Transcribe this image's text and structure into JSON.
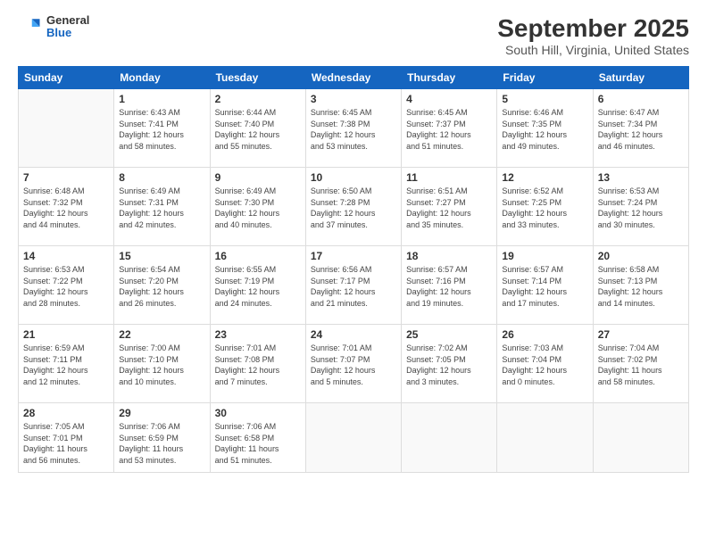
{
  "header": {
    "logo_general": "General",
    "logo_blue": "Blue",
    "main_title": "September 2025",
    "sub_title": "South Hill, Virginia, United States"
  },
  "calendar": {
    "days_of_week": [
      "Sunday",
      "Monday",
      "Tuesday",
      "Wednesday",
      "Thursday",
      "Friday",
      "Saturday"
    ],
    "weeks": [
      [
        {
          "day": "",
          "sunrise": "",
          "sunset": "",
          "daylight": ""
        },
        {
          "day": "1",
          "sunrise": "Sunrise: 6:43 AM",
          "sunset": "Sunset: 7:41 PM",
          "daylight": "Daylight: 12 hours and 58 minutes."
        },
        {
          "day": "2",
          "sunrise": "Sunrise: 6:44 AM",
          "sunset": "Sunset: 7:40 PM",
          "daylight": "Daylight: 12 hours and 55 minutes."
        },
        {
          "day": "3",
          "sunrise": "Sunrise: 6:45 AM",
          "sunset": "Sunset: 7:38 PM",
          "daylight": "Daylight: 12 hours and 53 minutes."
        },
        {
          "day": "4",
          "sunrise": "Sunrise: 6:45 AM",
          "sunset": "Sunset: 7:37 PM",
          "daylight": "Daylight: 12 hours and 51 minutes."
        },
        {
          "day": "5",
          "sunrise": "Sunrise: 6:46 AM",
          "sunset": "Sunset: 7:35 PM",
          "daylight": "Daylight: 12 hours and 49 minutes."
        },
        {
          "day": "6",
          "sunrise": "Sunrise: 6:47 AM",
          "sunset": "Sunset: 7:34 PM",
          "daylight": "Daylight: 12 hours and 46 minutes."
        }
      ],
      [
        {
          "day": "7",
          "sunrise": "Sunrise: 6:48 AM",
          "sunset": "Sunset: 7:32 PM",
          "daylight": "Daylight: 12 hours and 44 minutes."
        },
        {
          "day": "8",
          "sunrise": "Sunrise: 6:49 AM",
          "sunset": "Sunset: 7:31 PM",
          "daylight": "Daylight: 12 hours and 42 minutes."
        },
        {
          "day": "9",
          "sunrise": "Sunrise: 6:49 AM",
          "sunset": "Sunset: 7:30 PM",
          "daylight": "Daylight: 12 hours and 40 minutes."
        },
        {
          "day": "10",
          "sunrise": "Sunrise: 6:50 AM",
          "sunset": "Sunset: 7:28 PM",
          "daylight": "Daylight: 12 hours and 37 minutes."
        },
        {
          "day": "11",
          "sunrise": "Sunrise: 6:51 AM",
          "sunset": "Sunset: 7:27 PM",
          "daylight": "Daylight: 12 hours and 35 minutes."
        },
        {
          "day": "12",
          "sunrise": "Sunrise: 6:52 AM",
          "sunset": "Sunset: 7:25 PM",
          "daylight": "Daylight: 12 hours and 33 minutes."
        },
        {
          "day": "13",
          "sunrise": "Sunrise: 6:53 AM",
          "sunset": "Sunset: 7:24 PM",
          "daylight": "Daylight: 12 hours and 30 minutes."
        }
      ],
      [
        {
          "day": "14",
          "sunrise": "Sunrise: 6:53 AM",
          "sunset": "Sunset: 7:22 PM",
          "daylight": "Daylight: 12 hours and 28 minutes."
        },
        {
          "day": "15",
          "sunrise": "Sunrise: 6:54 AM",
          "sunset": "Sunset: 7:20 PM",
          "daylight": "Daylight: 12 hours and 26 minutes."
        },
        {
          "day": "16",
          "sunrise": "Sunrise: 6:55 AM",
          "sunset": "Sunset: 7:19 PM",
          "daylight": "Daylight: 12 hours and 24 minutes."
        },
        {
          "day": "17",
          "sunrise": "Sunrise: 6:56 AM",
          "sunset": "Sunset: 7:17 PM",
          "daylight": "Daylight: 12 hours and 21 minutes."
        },
        {
          "day": "18",
          "sunrise": "Sunrise: 6:57 AM",
          "sunset": "Sunset: 7:16 PM",
          "daylight": "Daylight: 12 hours and 19 minutes."
        },
        {
          "day": "19",
          "sunrise": "Sunrise: 6:57 AM",
          "sunset": "Sunset: 7:14 PM",
          "daylight": "Daylight: 12 hours and 17 minutes."
        },
        {
          "day": "20",
          "sunrise": "Sunrise: 6:58 AM",
          "sunset": "Sunset: 7:13 PM",
          "daylight": "Daylight: 12 hours and 14 minutes."
        }
      ],
      [
        {
          "day": "21",
          "sunrise": "Sunrise: 6:59 AM",
          "sunset": "Sunset: 7:11 PM",
          "daylight": "Daylight: 12 hours and 12 minutes."
        },
        {
          "day": "22",
          "sunrise": "Sunrise: 7:00 AM",
          "sunset": "Sunset: 7:10 PM",
          "daylight": "Daylight: 12 hours and 10 minutes."
        },
        {
          "day": "23",
          "sunrise": "Sunrise: 7:01 AM",
          "sunset": "Sunset: 7:08 PM",
          "daylight": "Daylight: 12 hours and 7 minutes."
        },
        {
          "day": "24",
          "sunrise": "Sunrise: 7:01 AM",
          "sunset": "Sunset: 7:07 PM",
          "daylight": "Daylight: 12 hours and 5 minutes."
        },
        {
          "day": "25",
          "sunrise": "Sunrise: 7:02 AM",
          "sunset": "Sunset: 7:05 PM",
          "daylight": "Daylight: 12 hours and 3 minutes."
        },
        {
          "day": "26",
          "sunrise": "Sunrise: 7:03 AM",
          "sunset": "Sunset: 7:04 PM",
          "daylight": "Daylight: 12 hours and 0 minutes."
        },
        {
          "day": "27",
          "sunrise": "Sunrise: 7:04 AM",
          "sunset": "Sunset: 7:02 PM",
          "daylight": "Daylight: 11 hours and 58 minutes."
        }
      ],
      [
        {
          "day": "28",
          "sunrise": "Sunrise: 7:05 AM",
          "sunset": "Sunset: 7:01 PM",
          "daylight": "Daylight: 11 hours and 56 minutes."
        },
        {
          "day": "29",
          "sunrise": "Sunrise: 7:06 AM",
          "sunset": "Sunset: 6:59 PM",
          "daylight": "Daylight: 11 hours and 53 minutes."
        },
        {
          "day": "30",
          "sunrise": "Sunrise: 7:06 AM",
          "sunset": "Sunset: 6:58 PM",
          "daylight": "Daylight: 11 hours and 51 minutes."
        },
        {
          "day": "",
          "sunrise": "",
          "sunset": "",
          "daylight": ""
        },
        {
          "day": "",
          "sunrise": "",
          "sunset": "",
          "daylight": ""
        },
        {
          "day": "",
          "sunrise": "",
          "sunset": "",
          "daylight": ""
        },
        {
          "day": "",
          "sunrise": "",
          "sunset": "",
          "daylight": ""
        }
      ]
    ]
  }
}
